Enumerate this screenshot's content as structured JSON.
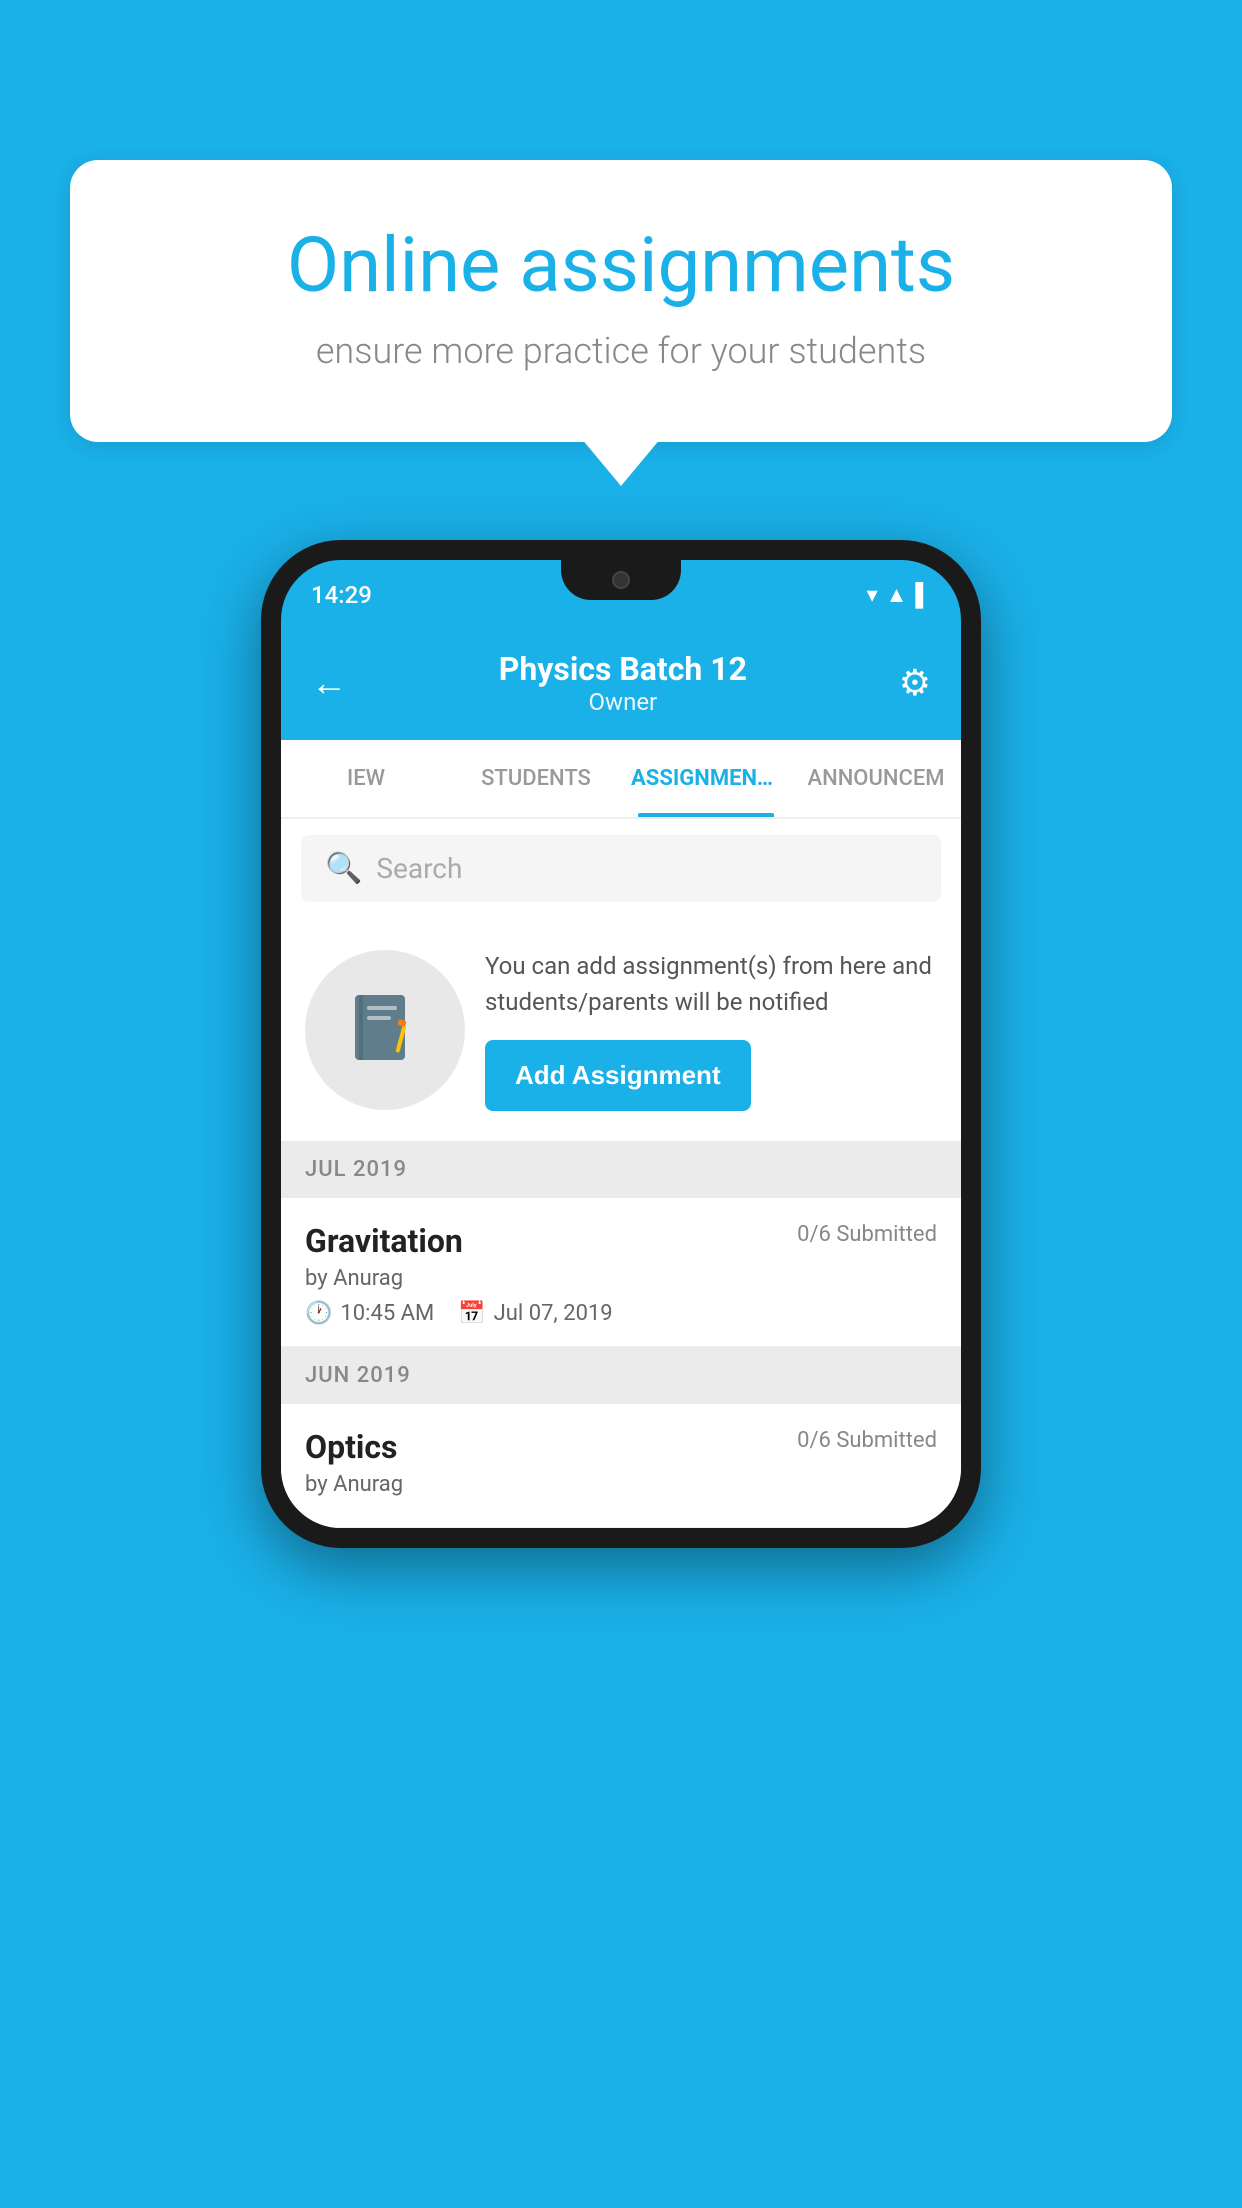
{
  "background_color": "#1ab0e8",
  "speech_bubble": {
    "title": "Online assignments",
    "subtitle": "ensure more practice for your students"
  },
  "phone": {
    "status_bar": {
      "time": "14:29",
      "icons": [
        "▼",
        "◄",
        "▌"
      ]
    },
    "app_bar": {
      "back_label": "←",
      "title": "Physics Batch 12",
      "subtitle": "Owner",
      "settings_label": "⚙"
    },
    "tabs": [
      {
        "label": "IEW",
        "active": false
      },
      {
        "label": "STUDENTS",
        "active": false
      },
      {
        "label": "ASSIGNMENTS",
        "active": true
      },
      {
        "label": "ANNOUNCEM",
        "active": false
      }
    ],
    "search": {
      "placeholder": "Search"
    },
    "info_section": {
      "description": "You can add assignment(s) from here and students/parents will be notified",
      "button_label": "Add Assignment"
    },
    "sections": [
      {
        "header": "JUL 2019",
        "assignments": [
          {
            "title": "Gravitation",
            "submitted": "0/6 Submitted",
            "by": "by Anurag",
            "time": "10:45 AM",
            "date": "Jul 07, 2019"
          }
        ]
      },
      {
        "header": "JUN 2019",
        "assignments": [
          {
            "title": "Optics",
            "submitted": "0/6 Submitted",
            "by": "by Anurag",
            "time": "",
            "date": ""
          }
        ]
      }
    ]
  }
}
